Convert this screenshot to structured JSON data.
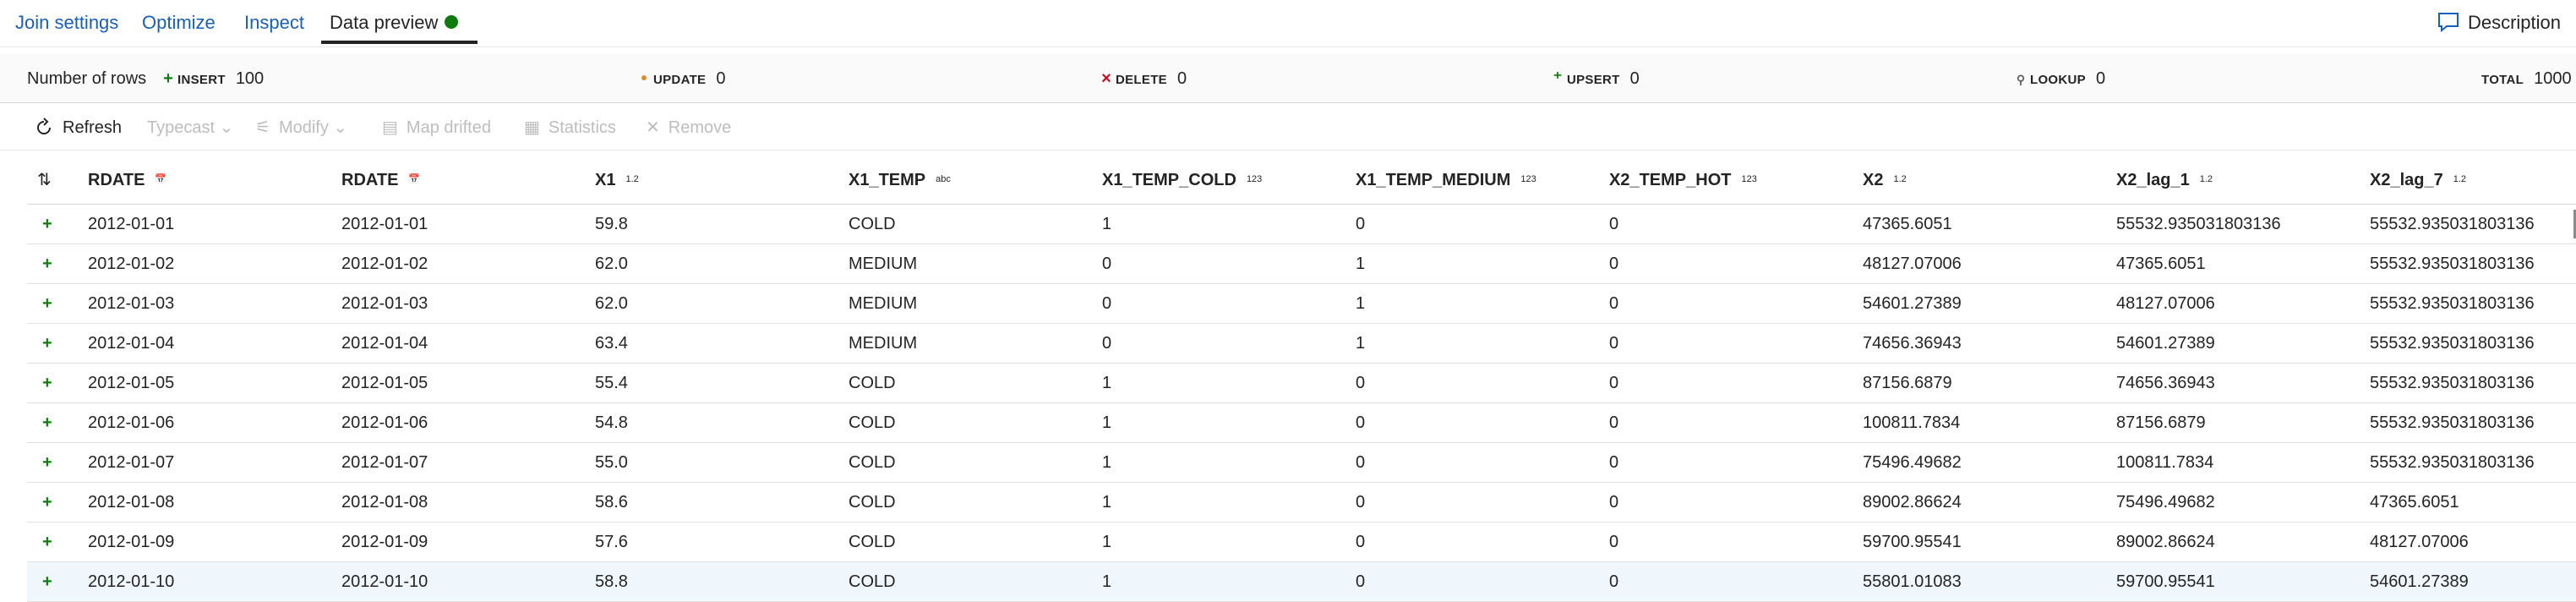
{
  "tabs": [
    {
      "label": "Join settings"
    },
    {
      "label": "Optimize"
    },
    {
      "label": "Inspect"
    },
    {
      "label": "Data preview"
    }
  ],
  "status_color": "#0f7b0f",
  "description_label": "Description",
  "rows_summary": {
    "label": "Number of rows",
    "insert": {
      "label": "INSERT",
      "value": "100"
    },
    "update": {
      "label": "UPDATE",
      "value": "0"
    },
    "delete": {
      "label": "DELETE",
      "value": "0"
    },
    "upsert": {
      "label": "UPSERT",
      "value": "0"
    },
    "lookup": {
      "label": "LOOKUP",
      "value": "0"
    },
    "total": {
      "label": "TOTAL",
      "value": "1000"
    }
  },
  "toolbar": {
    "refresh": "Refresh",
    "typecast": "Typecast",
    "modify": "Modify",
    "map_drifted": "Map drifted",
    "statistics": "Statistics",
    "remove": "Remove"
  },
  "columns": [
    {
      "name": "RDATE",
      "type": "date-icon"
    },
    {
      "name": "RDATE",
      "type": "date-icon"
    },
    {
      "name": "X1",
      "type": "1.2"
    },
    {
      "name": "X1_TEMP",
      "type": "abc"
    },
    {
      "name": "X1_TEMP_COLD",
      "type": "123"
    },
    {
      "name": "X1_TEMP_MEDIUM",
      "type": "123"
    },
    {
      "name": "X2_TEMP_HOT",
      "type": "123"
    },
    {
      "name": "X2",
      "type": "1.2"
    },
    {
      "name": "X2_lag_1",
      "type": "1.2"
    },
    {
      "name": "X2_lag_7",
      "type": "1.2"
    }
  ],
  "rows": [
    [
      "2012-01-01",
      "2012-01-01",
      "59.8",
      "COLD",
      "1",
      "0",
      "0",
      "47365.6051",
      "55532.935031803136",
      "55532.935031803136"
    ],
    [
      "2012-01-02",
      "2012-01-02",
      "62.0",
      "MEDIUM",
      "0",
      "1",
      "0",
      "48127.07006",
      "47365.6051",
      "55532.935031803136"
    ],
    [
      "2012-01-03",
      "2012-01-03",
      "62.0",
      "MEDIUM",
      "0",
      "1",
      "0",
      "54601.27389",
      "48127.07006",
      "55532.935031803136"
    ],
    [
      "2012-01-04",
      "2012-01-04",
      "63.4",
      "MEDIUM",
      "0",
      "1",
      "0",
      "74656.36943",
      "54601.27389",
      "55532.935031803136"
    ],
    [
      "2012-01-05",
      "2012-01-05",
      "55.4",
      "COLD",
      "1",
      "0",
      "0",
      "87156.6879",
      "74656.36943",
      "55532.935031803136"
    ],
    [
      "2012-01-06",
      "2012-01-06",
      "54.8",
      "COLD",
      "1",
      "0",
      "0",
      "100811.7834",
      "87156.6879",
      "55532.935031803136"
    ],
    [
      "2012-01-07",
      "2012-01-07",
      "55.0",
      "COLD",
      "1",
      "0",
      "0",
      "75496.49682",
      "100811.7834",
      "55532.935031803136"
    ],
    [
      "2012-01-08",
      "2012-01-08",
      "58.6",
      "COLD",
      "1",
      "0",
      "0",
      "89002.86624",
      "75496.49682",
      "47365.6051"
    ],
    [
      "2012-01-09",
      "2012-01-09",
      "57.6",
      "COLD",
      "1",
      "0",
      "0",
      "59700.95541",
      "89002.86624",
      "48127.07006"
    ],
    [
      "2012-01-10",
      "2012-01-10",
      "58.8",
      "COLD",
      "1",
      "0",
      "0",
      "55801.01083",
      "59700.95541",
      "54601.27389"
    ]
  ]
}
